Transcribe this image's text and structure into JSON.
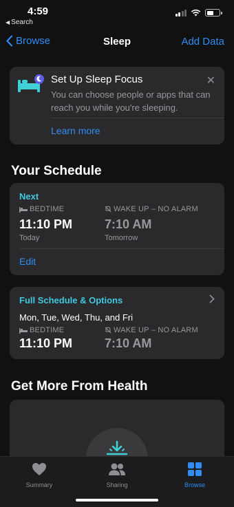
{
  "status": {
    "time": "4:59",
    "back_app": "Search"
  },
  "nav": {
    "back_label": "Browse",
    "title": "Sleep",
    "action_label": "Add Data"
  },
  "focus": {
    "title": "Set Up Sleep Focus",
    "description": "You can choose people or apps that can reach you while you're sleeping.",
    "link": "Learn more"
  },
  "schedule": {
    "section_title": "Your Schedule",
    "next": {
      "heading": "Next",
      "bedtime_label": "BEDTIME",
      "bedtime": "11:10 PM",
      "bedtime_day": "Today",
      "wake_label": "WAKE UP – NO ALARM",
      "wake": "7:10 AM",
      "wake_day": "Tomorrow",
      "edit": "Edit"
    },
    "full": {
      "heading": "Full Schedule & Options",
      "days": "Mon, Tue, Wed, Thu, and Fri",
      "bedtime_label": "BEDTIME",
      "bedtime": "11:10 PM",
      "wake_label": "WAKE UP – NO ALARM",
      "wake": "7:10 AM"
    }
  },
  "more": {
    "section_title": "Get More From Health"
  },
  "tabs": [
    {
      "label": "Summary",
      "icon": "heart-icon",
      "active": false
    },
    {
      "label": "Sharing",
      "icon": "people-icon",
      "active": false
    },
    {
      "label": "Browse",
      "icon": "grid-icon",
      "active": true
    }
  ],
  "colors": {
    "accent_blue": "#2f8df5",
    "teal": "#40c8e0",
    "card": "#2a2a2c",
    "background": "#111112"
  }
}
